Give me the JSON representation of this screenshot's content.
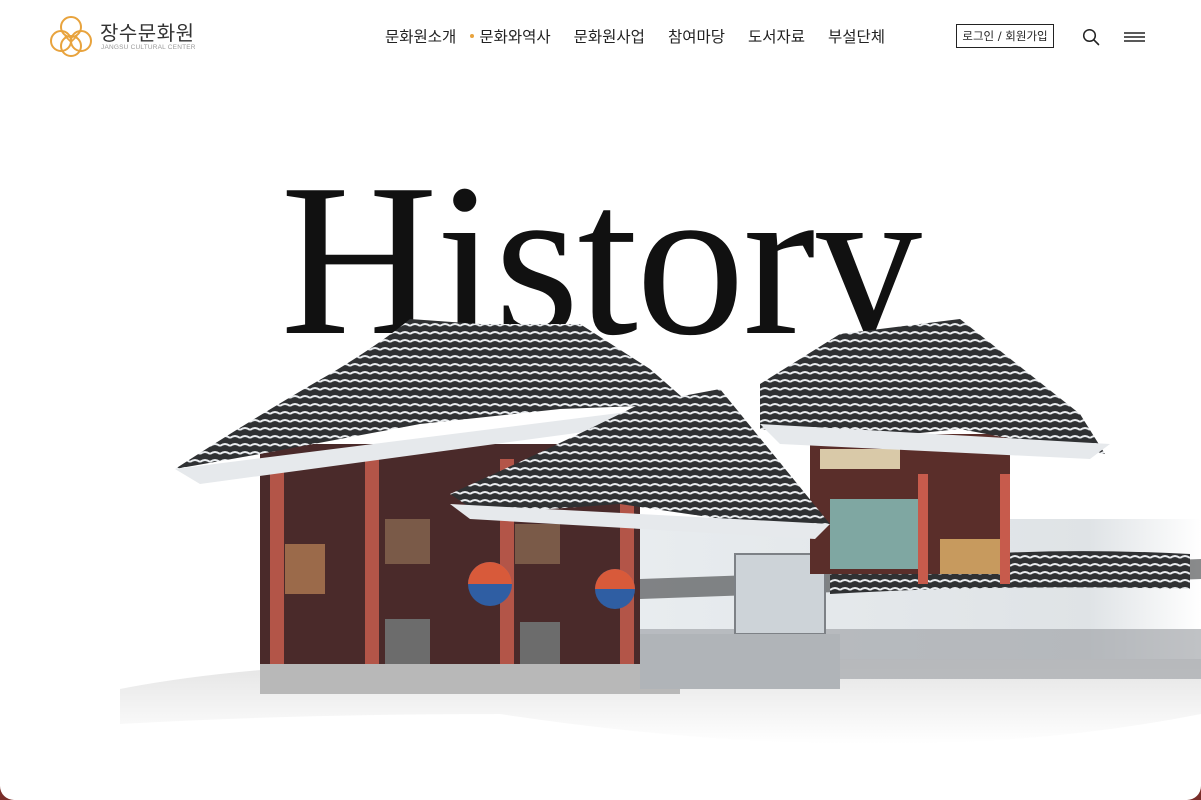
{
  "header": {
    "logo": {
      "name_ko": "장수문화원",
      "name_en": "JANGSU CULTURAL CENTER"
    },
    "nav": [
      {
        "label": "문화원소개",
        "active": false
      },
      {
        "label": "문화와역사",
        "active": true
      },
      {
        "label": "문화원사업",
        "active": false
      },
      {
        "label": "참여마당",
        "active": false
      },
      {
        "label": "도서자료",
        "active": false
      },
      {
        "label": "부설단체",
        "active": false
      }
    ],
    "login_label": "로그인 / 회원가입",
    "search_icon": "search-icon",
    "menu_icon": "hamburger-menu-icon"
  },
  "hero": {
    "title": "History",
    "image": "hanok-gate-snow-illustration"
  },
  "colors": {
    "accent": "#e8a33d",
    "text": "#222222",
    "frame": "#7a2e2a"
  }
}
